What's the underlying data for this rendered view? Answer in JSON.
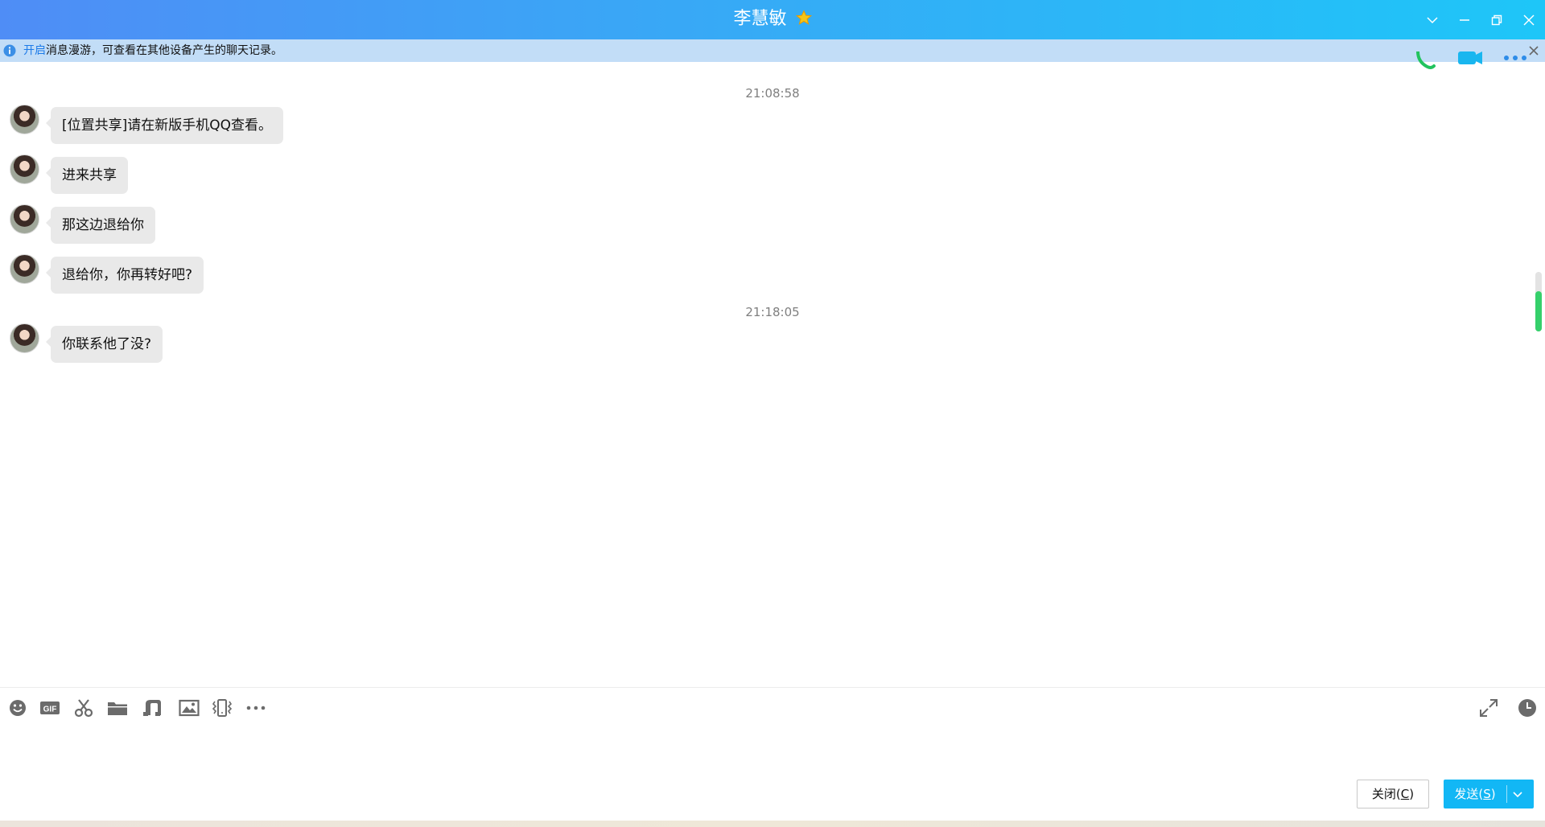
{
  "window": {
    "title": "李慧敏",
    "colors": {
      "accent": "#12b7f5",
      "titlebar_start": "#4f8df6",
      "titlebar_end": "#1ec6f8",
      "scroll_thumb": "#35d06b"
    }
  },
  "notice": {
    "link": "开启",
    "text": "消息漫游，可查看在其他设备产生的聊天记录。"
  },
  "messages": {
    "time1": "21:08:58",
    "msg1": "[位置共享]请在新版手机QQ查看。",
    "msg2": "进来共享",
    "msg3": "那这边退给你",
    "msg4": "退给你，你再转好吧?",
    "time2": "21:18:05",
    "msg5": "你联系他了没?"
  },
  "toolbar": {
    "icons": [
      "emoji-icon",
      "gif-icon",
      "scissors-icon",
      "folder-icon",
      "music-icon",
      "image-icon",
      "shake-icon",
      "more-icon",
      "expand-icon",
      "history-icon"
    ]
  },
  "input": {
    "value": ""
  },
  "buttons": {
    "close_text": "关闭(",
    "close_key": "C",
    "close_end": ")",
    "send_text": "发送(",
    "send_key": "S",
    "send_end": ")"
  }
}
